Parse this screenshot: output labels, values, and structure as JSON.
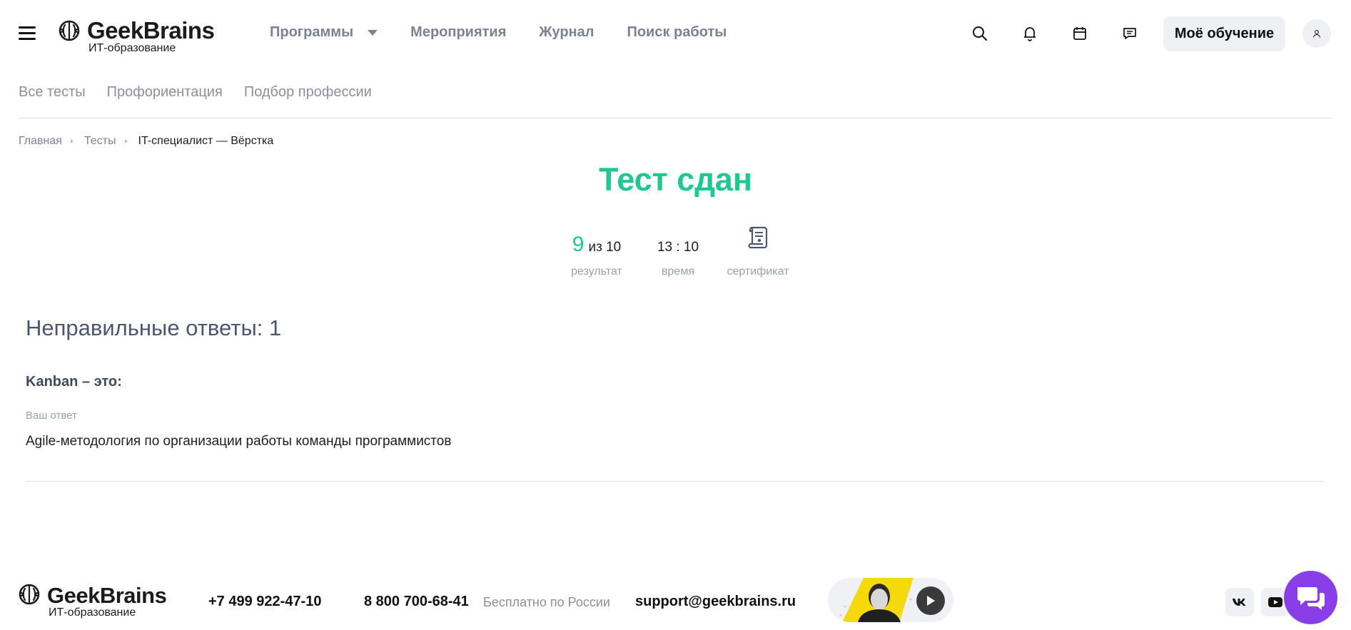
{
  "header": {
    "logo_name": "GeekBrains",
    "logo_sub": "ИТ-образование",
    "nav": [
      {
        "label": "Программы"
      },
      {
        "label": "Мероприятия"
      },
      {
        "label": "Журнал"
      },
      {
        "label": "Поиск работы"
      }
    ],
    "learning_button": "Моё обучение",
    "icons": [
      "search-icon",
      "bell-icon",
      "calendar-icon",
      "chat-icon",
      "user-icon"
    ]
  },
  "subnav": [
    {
      "label": "Все тесты"
    },
    {
      "label": "Профориентация"
    },
    {
      "label": "Подбор профессии"
    }
  ],
  "breadcrumb": {
    "home": "Главная",
    "tests": "Тесты",
    "current": "IT-специалист — Вёрстка"
  },
  "result": {
    "title": "Тест сдан",
    "score": "9",
    "score_of": "из 10",
    "score_label": "результат",
    "time": "13 : 10",
    "time_label": "время",
    "certificate_label": "сертификат"
  },
  "wrong_answers": {
    "title": "Неправильные ответы: 1",
    "items": [
      {
        "question": "Kanban – это:",
        "answer_label": "Ваш ответ",
        "answer": "Agile-методология по организации работы команды программистов"
      }
    ]
  },
  "footer": {
    "logo_name": "GeekBrains",
    "logo_sub": "ИТ-образование",
    "phone_1": "+7 499 922-47-10",
    "phone_2": "8 800 700-68-41",
    "phone_2_note": "Бесплатно по России",
    "email": "support@geekbrains.ru",
    "social": [
      "vk-icon",
      "youtube-icon"
    ]
  },
  "colors": {
    "accent_green": "#1ec98f",
    "chat_purple": "#8a3ee8",
    "muted_text": "#8a909c"
  }
}
